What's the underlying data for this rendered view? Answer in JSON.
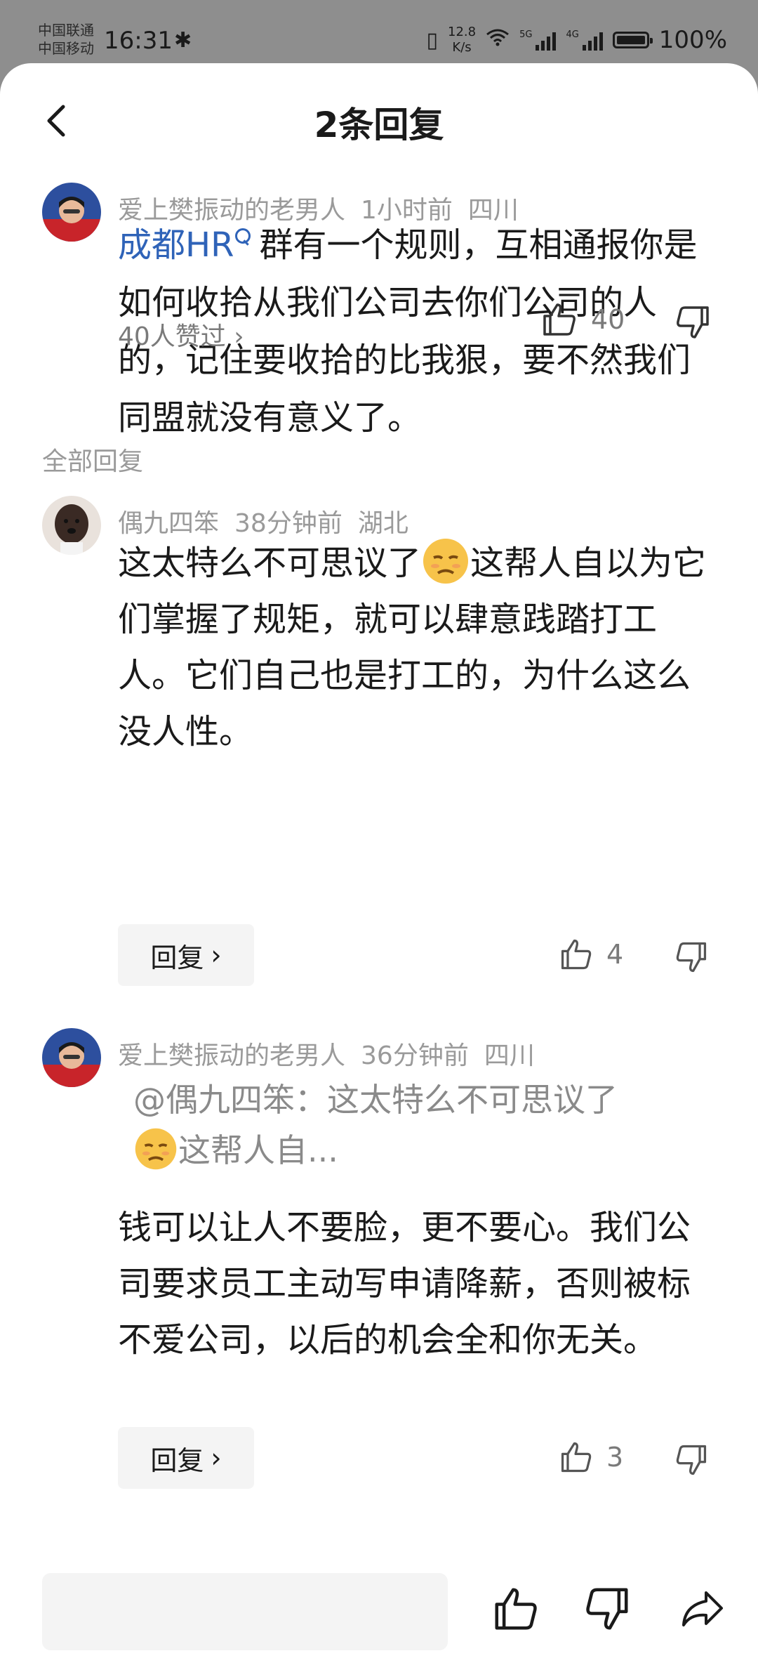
{
  "status_bar": {
    "carrier_1": "中国联通",
    "carrier_2": "中国移动",
    "time": "16:31",
    "net_speed_value": "12.8",
    "net_speed_unit": "K/s",
    "sig1_label": "5G",
    "sig2_label": "4G",
    "battery": "100%"
  },
  "header": {
    "title": "2条回复"
  },
  "main_comment": {
    "author": "爱上樊振动的老男人",
    "time": "1小时前",
    "location": "四川",
    "link_text": "成都HR",
    "text": "群有一个规则，互相通报你是如何收拾从我们公司去你们公司的人的，记住要收拾的比我狠，要不然我们同盟就没有意义了。",
    "likes_summary": "40人赞过",
    "like_count": "40"
  },
  "section_label": "全部回复",
  "replies": [
    {
      "author": "偶九四笨",
      "time": "38分钟前",
      "location": "湖北",
      "text_before_emoji": "这太特么不可思议了",
      "text_after_emoji": "这帮人自以为它们掌握了规矩，就可以肆意践踏打工人。它们自己也是打工的，为什么这么没人性。",
      "reply_label": "回复",
      "like_count": "4"
    },
    {
      "author": "爱上樊振动的老男人",
      "time": "36分钟前",
      "location": "四川",
      "quote_before_emoji": "@偶九四笨：这太特么不可思议了",
      "quote_after_emoji": "这帮人自...",
      "text": "钱可以让人不要脸，更不要心。我们公司要求员工主动写申请降薪，否则被标不爱公司，以后的机会全和你无关。",
      "reply_label": "回复",
      "like_count": "3"
    }
  ],
  "icons": {
    "back": "chevron-left-icon",
    "like": "thumbs-up-icon",
    "dislike": "thumbs-down-icon",
    "share": "share-icon"
  },
  "colors": {
    "link": "#2f63b8",
    "meta": "#9a9a9a",
    "sheet": "#ffffff",
    "backdrop": "#8e8e8e"
  }
}
